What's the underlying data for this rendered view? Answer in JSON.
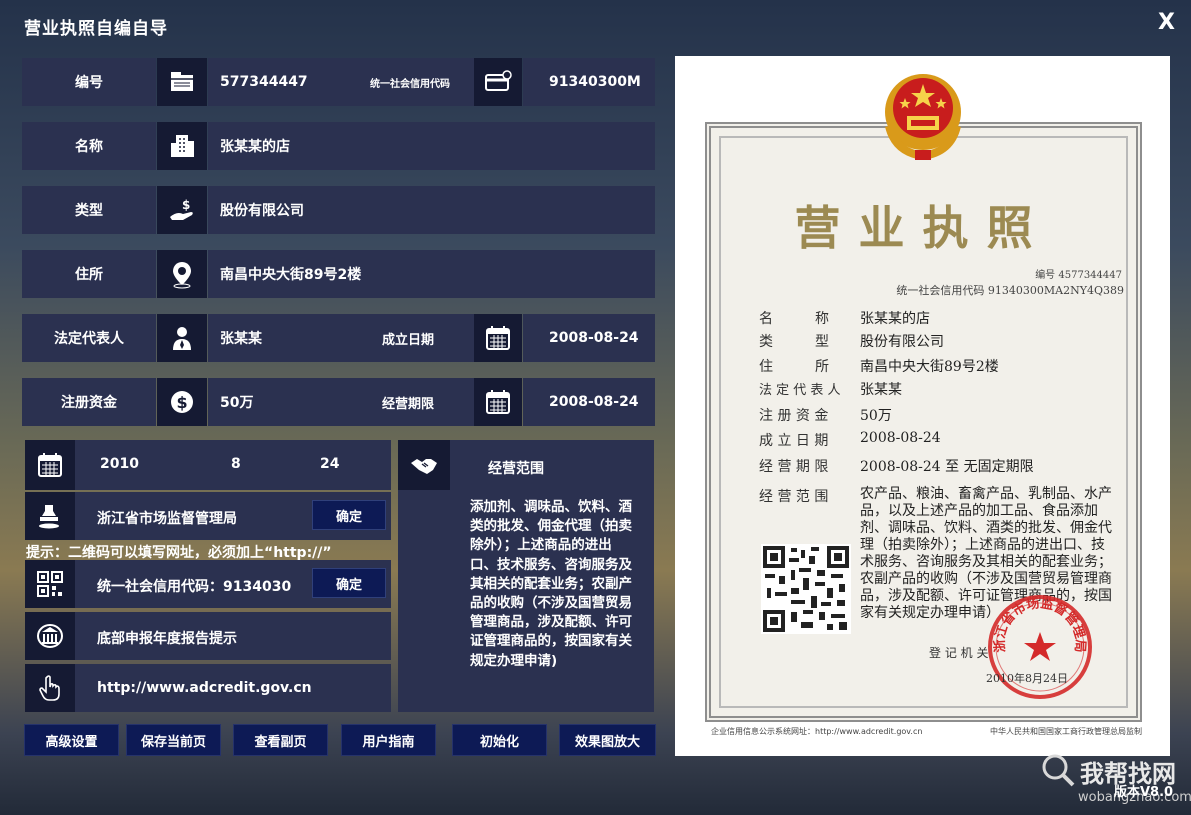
{
  "window": {
    "title": "营业执照自编自导",
    "close_label": "X"
  },
  "form": {
    "number_label": "编号",
    "number_value": "577344447",
    "credit_label": "统一社会信用代码",
    "credit_value": "91340300M",
    "name_label": "名称",
    "name_value": "张某某的店",
    "type_label": "类型",
    "type_value": "股份有限公司",
    "address_label": "住所",
    "address_value": "南昌中央大街89号2楼",
    "legal_rep_label": "法定代表人",
    "legal_rep_value": "张某某",
    "established_label": "成立日期",
    "established_value": "2008-08-24",
    "capital_label": "注册资金",
    "capital_value": "50万",
    "term_label": "经营期限",
    "term_value": "2008-08-24"
  },
  "issue": {
    "year": "2010",
    "month": "8",
    "day": "24",
    "authority": "浙江省市场监督管理局",
    "confirm_label": "确定",
    "hint": "提示：二维码可以填写网址，必须加上“http://”",
    "qr_text": "统一社会信用代码：9134030",
    "qr_confirm_label": "确定",
    "bottom_notice": "底部申报年度报告提示",
    "url": "http://www.adcredit.gov.cn"
  },
  "scope": {
    "label": "经营范围",
    "text": "添加剂、调味品、饮料、酒类的批发、佣金代理（拍卖除外）；上述商品的进出口、技术服务、咨询服务及其相关的配套业务；农副产品的收购（不涉及国营贸易管理商品，涉及配额、许可证管理商品的，按国家有关规定办理申请)"
  },
  "buttons": {
    "advanced": "高级设置",
    "save": "保存当前页",
    "view": "查看副页",
    "guide": "用户指南",
    "reset": "初始化",
    "zoom": "效果图放大"
  },
  "certificate": {
    "title": "营业执照",
    "no_line": "编号 4577344447",
    "code_line": "统一社会信用代码 91340300MA2NY4Q389",
    "labels": [
      "名　　　称",
      "类　　　型",
      "住　　　所",
      "法 定 代 表 人",
      "注 册 资 金",
      "成 立 日 期",
      "经 营 期 限",
      "经 营 范 围"
    ],
    "values": [
      "张某某的店",
      "股份有限公司",
      "南昌中央大街89号2楼",
      "张某某",
      "50万",
      "2008-08-24",
      "2008-08-24 至 无固定期限"
    ],
    "scope": "农产品、粮油、畜禽产品、乳制品、水产品，以及上述产品的加工品、食品添加剂、调味品、饮料、酒类的批发、佣金代理（拍卖除外）；上述商品的进出口、技术服务、咨询服务及其相关的配套业务；农副产品的收购（不涉及国营贸易管理商品，涉及配额、许可证管理商品的，按国家有关规定办理申请）",
    "reg_label": "登 记 机 关",
    "reg_date": "2010年8月24日",
    "seal_text": "浙江省市场监督管理局",
    "footer_left": "企业信用信息公示系统网址：http://www.adcredit.gov.cn",
    "footer_right": "中华人民共和国国家工商行政管理总局监制"
  },
  "version": "版本V8.0",
  "watermark": {
    "line1": "我帮找网",
    "line2": "wobangzhao.com"
  }
}
